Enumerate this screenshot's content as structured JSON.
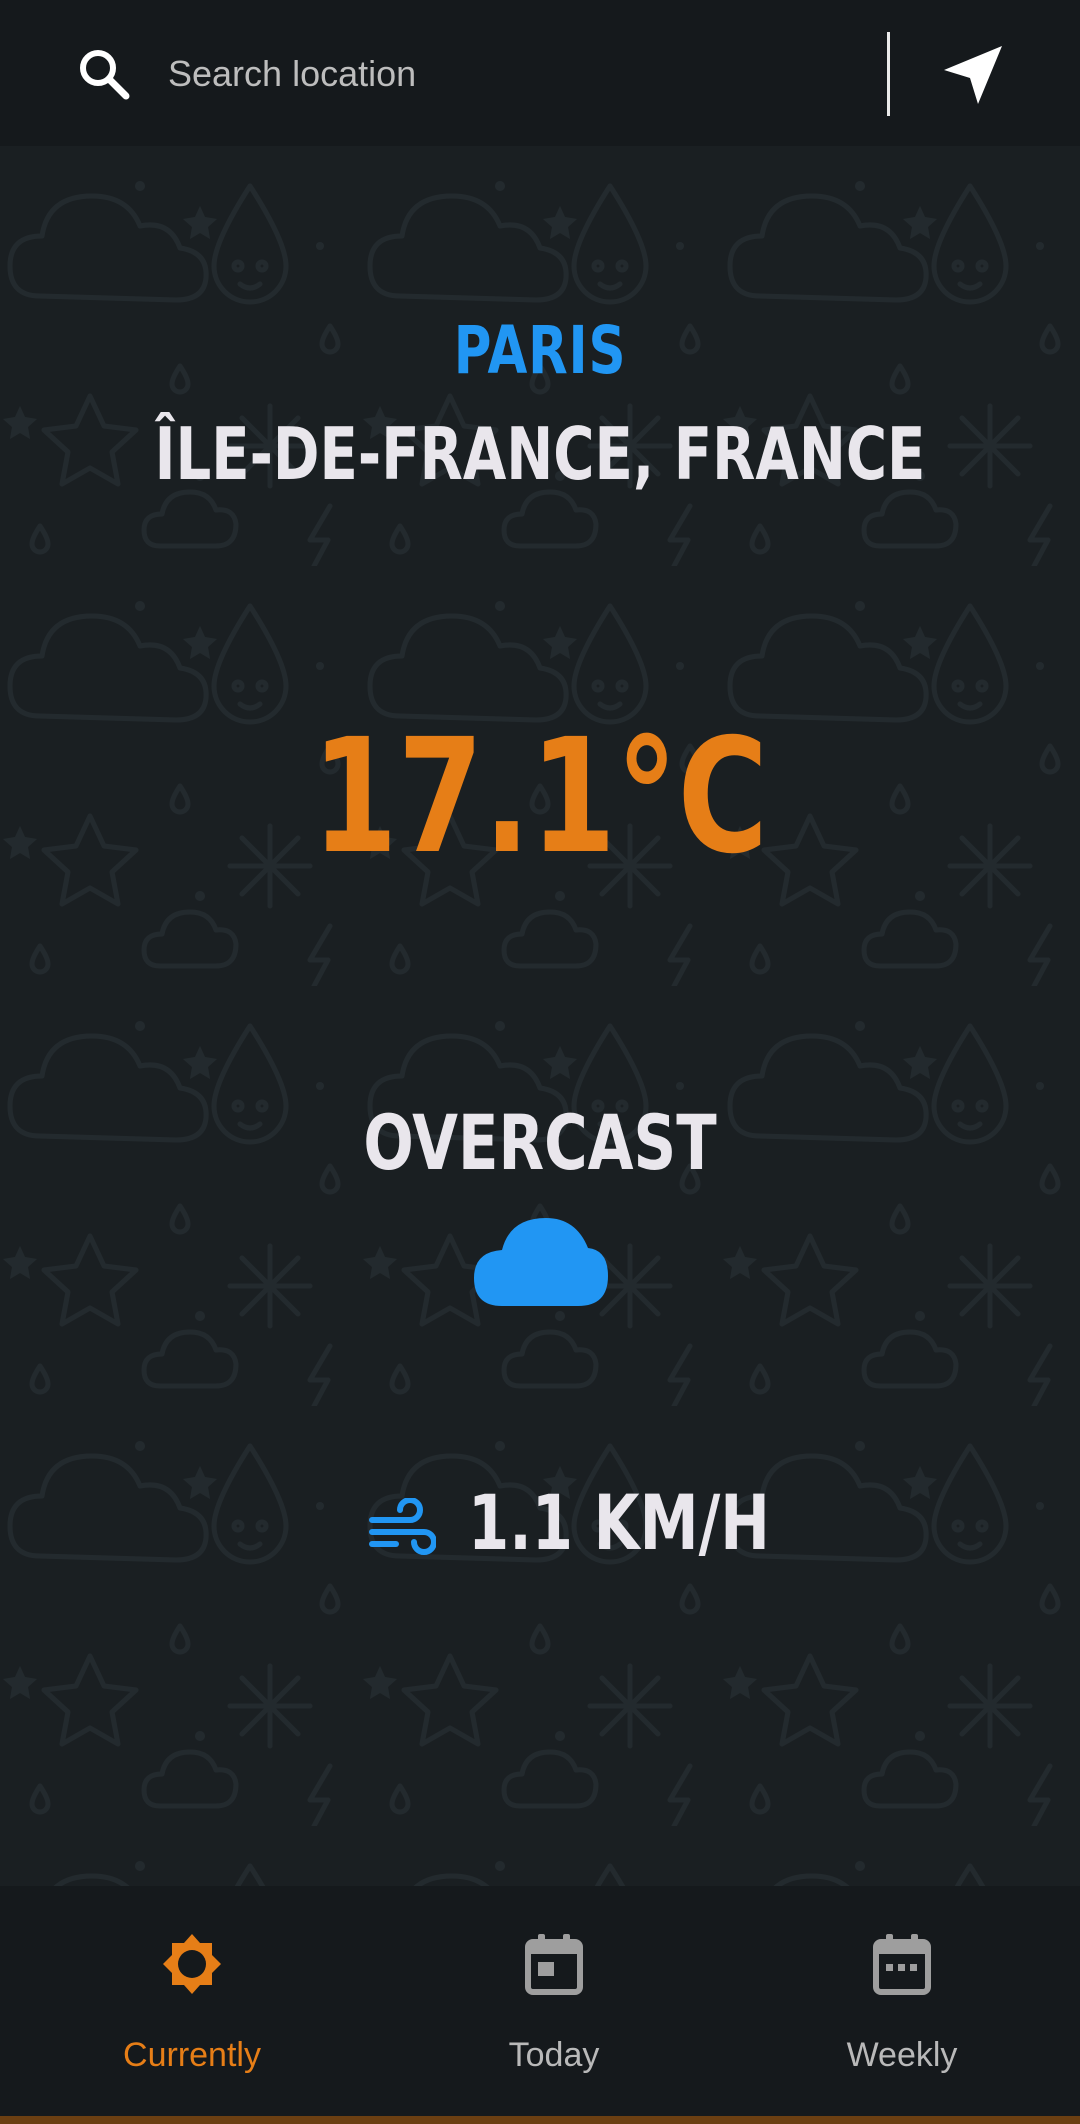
{
  "search": {
    "placeholder": "Search location",
    "icon": "search-icon"
  },
  "location_button": {
    "icon": "navigation-arrow-icon"
  },
  "location": {
    "city": "PARIS",
    "region": "ÎLE-DE-FRANCE, FRANCE"
  },
  "weather": {
    "temperature": "17.1°C",
    "condition": "OVERCAST",
    "condition_icon": "cloud-icon",
    "wind_icon": "wind-icon",
    "wind_speed": "1.1 KM/H"
  },
  "nav": {
    "items": [
      {
        "label": "Currently",
        "icon": "sun-icon",
        "active": true
      },
      {
        "label": "Today",
        "icon": "calendar-day-icon",
        "active": false
      },
      {
        "label": "Weekly",
        "icon": "calendar-week-icon",
        "active": false
      }
    ]
  },
  "colors": {
    "accent_orange": "#e67e17",
    "accent_blue": "#2196f3",
    "background": "#1a1f22",
    "bar_background": "#15191c",
    "text_light": "#e9e6ec"
  }
}
